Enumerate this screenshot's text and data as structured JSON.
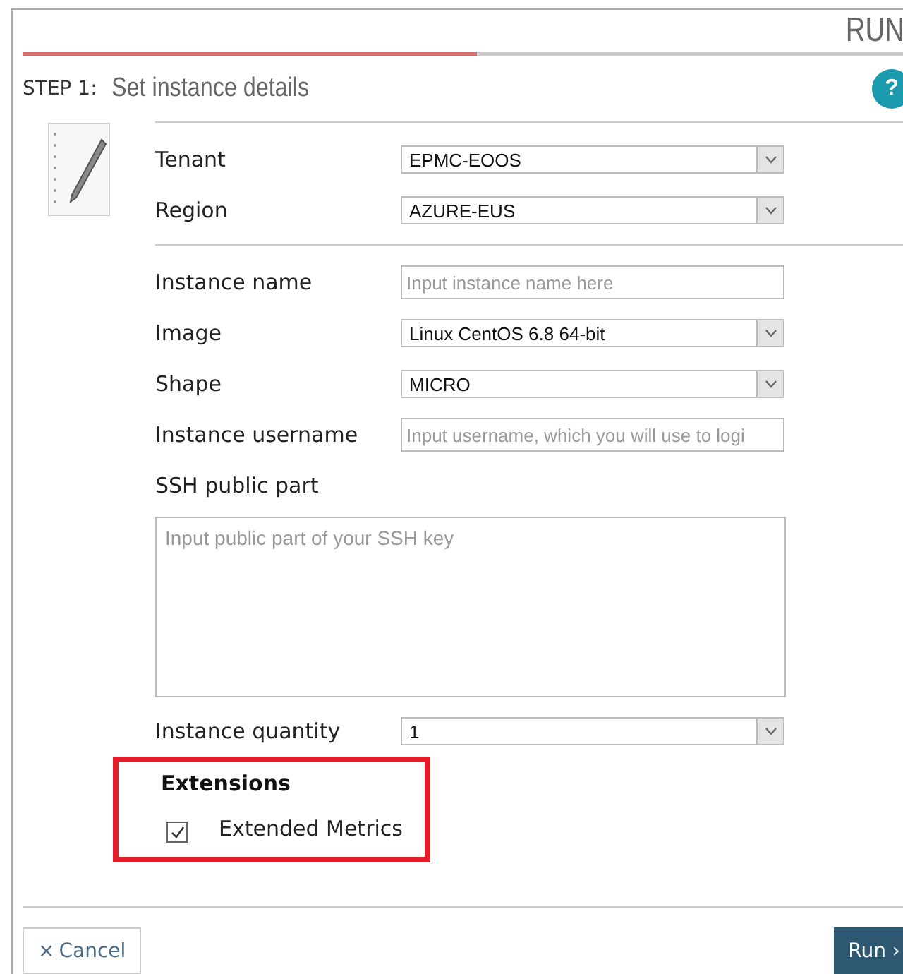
{
  "dialog": {
    "title": "RUN",
    "progress": {
      "level": 0.51
    }
  },
  "step": {
    "number": "STEP 1:",
    "title": "Set instance details",
    "help": "?"
  },
  "location_fields": [
    {
      "kind": "select",
      "label": "Tenant",
      "value": "EPMC-EOOS"
    },
    {
      "kind": "select",
      "label": "Region",
      "value": "AZURE-EUS"
    }
  ],
  "instance_fields": [
    {
      "kind": "input",
      "label": "Instance name",
      "placeholder": "Input instance name here"
    },
    {
      "kind": "select",
      "label": "Image",
      "value": "Linux CentOS 6.8 64-bit"
    },
    {
      "kind": "select",
      "label": "Shape",
      "value": "MICRO"
    },
    {
      "kind": "input",
      "label": "Instance username",
      "placeholder": "Input username, which you will use to logi"
    }
  ],
  "ssh": {
    "label": "SSH public part",
    "placeholder": "Input public part of your SSH key"
  },
  "quantity": {
    "label": "Instance quantity",
    "value": "1"
  },
  "extensions": {
    "title": "Extensions",
    "highlighted": true,
    "items": [
      {
        "label": "Extended Metrics",
        "checked": true
      }
    ]
  },
  "buttons": {
    "cancel_icon": "×",
    "cancel": "Cancel",
    "run": "Run",
    "run_icon": "›"
  }
}
